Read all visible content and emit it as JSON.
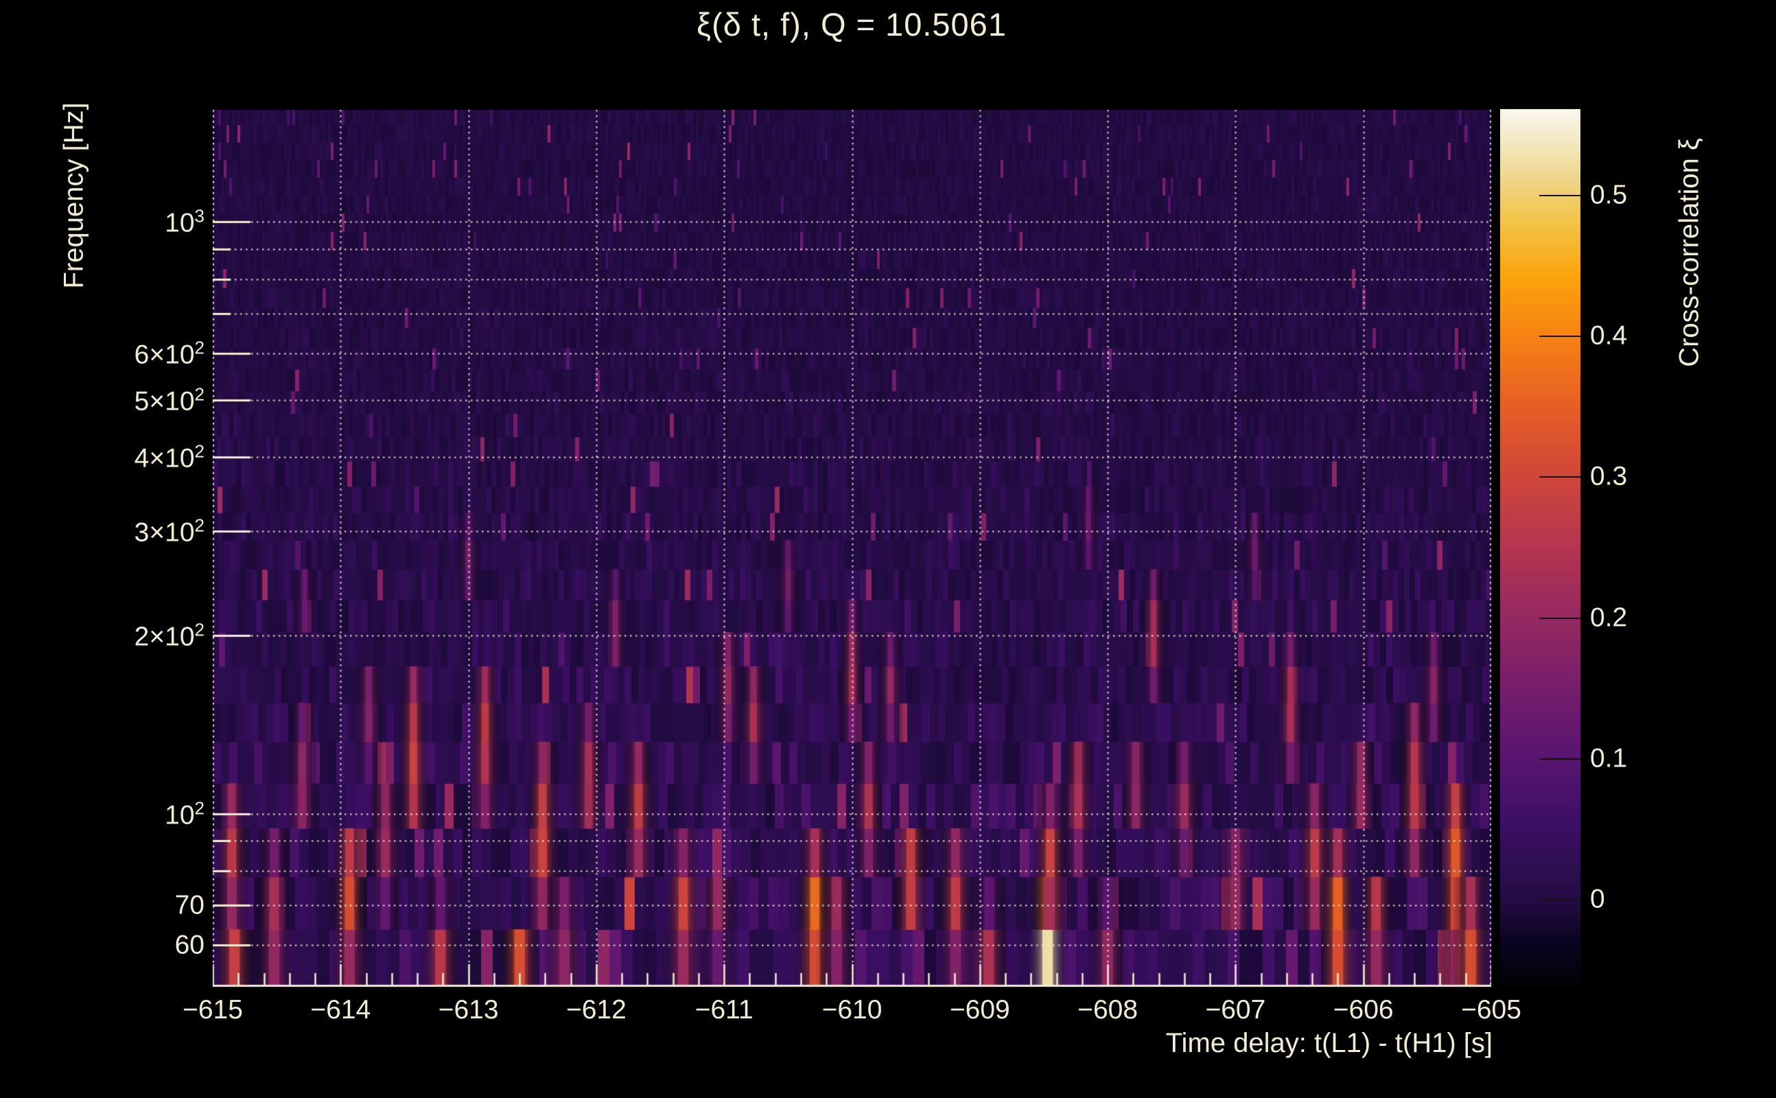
{
  "page": {
    "title": "ξ(δ t, f), Q = 10.5061",
    "background": "#000000",
    "text_color": "#f3ecd4"
  },
  "chart_data": {
    "type": "heatmap",
    "title": "ξ(δ t, f), Q = 10.5061",
    "q_value": "10.5061",
    "xlabel": "Time delay: t(L1) - t(H1) [s]",
    "ylabel": "Frequency [Hz]",
    "x_range": [
      -615,
      -605
    ],
    "x_minor_step": 0.2,
    "x_ticks": [
      {
        "label": "−615",
        "value": -615
      },
      {
        "label": "−614",
        "value": -614
      },
      {
        "label": "−613",
        "value": -613
      },
      {
        "label": "−612",
        "value": -612
      },
      {
        "label": "−611",
        "value": -611
      },
      {
        "label": "−610",
        "value": -610
      },
      {
        "label": "−609",
        "value": -609
      },
      {
        "label": "−608",
        "value": -608
      },
      {
        "label": "−607",
        "value": -607
      },
      {
        "label": "−606",
        "value": -606
      },
      {
        "label": "−605",
        "value": -605
      }
    ],
    "y_scale": "log",
    "y_range": [
      51,
      1546
    ],
    "y_ticks": [
      {
        "label": "10",
        "sup": "3",
        "value": 1000
      },
      {
        "label": "6×10",
        "sup": "2",
        "value": 600
      },
      {
        "label": "5×10",
        "sup": "2",
        "value": 500
      },
      {
        "label": "4×10",
        "sup": "2",
        "value": 400
      },
      {
        "label": "3×10",
        "sup": "2",
        "value": 300
      },
      {
        "label": "2×10",
        "sup": "2",
        "value": 200
      },
      {
        "label": "10",
        "sup": "2",
        "value": 100
      },
      {
        "label": "70",
        "sup": "",
        "value": 70
      },
      {
        "label": "60",
        "sup": "",
        "value": 60
      }
    ],
    "y_minor_gridlines": [
      900,
      800,
      700,
      90,
      80
    ],
    "grid": {
      "style": "dotted",
      "color": "#f6efd8"
    },
    "colorbar": {
      "label": "Cross-correlation ξ",
      "min": -0.063,
      "max": 0.561,
      "ticks": [
        {
          "label": "0.5",
          "value": 0.5
        },
        {
          "label": "0.4",
          "value": 0.4
        },
        {
          "label": "0.3",
          "value": 0.3
        },
        {
          "label": "0.2",
          "value": 0.2
        },
        {
          "label": "0.1",
          "value": 0.1
        },
        {
          "label": "0",
          "value": 0
        }
      ]
    },
    "colormap": {
      "name": "inferno-like",
      "stops": [
        [
          0.0,
          "#020104"
        ],
        [
          0.05,
          "#0a0420"
        ],
        [
          0.101,
          "#240c44"
        ],
        [
          0.18,
          "#3b0f63"
        ],
        [
          0.261,
          "#581570"
        ],
        [
          0.34,
          "#751d6c"
        ],
        [
          0.42,
          "#942961"
        ],
        [
          0.5,
          "#b33550"
        ],
        [
          0.58,
          "#cf463b"
        ],
        [
          0.66,
          "#e55e25"
        ],
        [
          0.74,
          "#f58212"
        ],
        [
          0.81,
          "#fba40c"
        ],
        [
          0.87,
          "#f3c245"
        ],
        [
          0.92,
          "#eed688"
        ],
        [
          0.965,
          "#f4e9c5"
        ],
        [
          1.0,
          "#f9f6ee"
        ]
      ]
    },
    "noise": {
      "seed": 9,
      "description": "stochastic constant-Q tile background, variance increasing toward low frequency"
    },
    "features": [
      {
        "t": -614.85,
        "f1": 70,
        "f2": 105,
        "xi": 0.26
      },
      {
        "t": -614.83,
        "f1": 50,
        "f2": 60,
        "xi": 0.3
      },
      {
        "t": -614.52,
        "f1": 55,
        "f2": 80,
        "xi": 0.24
      },
      {
        "t": -614.3,
        "f1": 95,
        "f2": 135,
        "xi": 0.2
      },
      {
        "t": -614.28,
        "f1": 205,
        "f2": 255,
        "xi": 0.14
      },
      {
        "t": -613.93,
        "f1": 60,
        "f2": 90,
        "xi": 0.32
      },
      {
        "t": -613.78,
        "f1": 130,
        "f2": 175,
        "xi": 0.18
      },
      {
        "t": -613.65,
        "f1": 78,
        "f2": 108,
        "xi": 0.22
      },
      {
        "t": -613.43,
        "f1": 95,
        "f2": 160,
        "xi": 0.29
      },
      {
        "t": -613.22,
        "f1": 52,
        "f2": 64,
        "xi": 0.26
      },
      {
        "t": -613.0,
        "f1": 235,
        "f2": 300,
        "xi": 0.15
      },
      {
        "t": -612.87,
        "f1": 110,
        "f2": 170,
        "xi": 0.27
      },
      {
        "t": -612.6,
        "f1": 50,
        "f2": 60,
        "xi": 0.34
      },
      {
        "t": -612.42,
        "f1": 75,
        "f2": 115,
        "xi": 0.3
      },
      {
        "t": -612.25,
        "f1": 55,
        "f2": 70,
        "xi": 0.22
      },
      {
        "t": -612.06,
        "f1": 95,
        "f2": 135,
        "xi": 0.24
      },
      {
        "t": -611.85,
        "f1": 180,
        "f2": 230,
        "xi": 0.18
      },
      {
        "t": -611.67,
        "f1": 85,
        "f2": 122,
        "xi": 0.27
      },
      {
        "t": -611.32,
        "f1": 58,
        "f2": 80,
        "xi": 0.3
      },
      {
        "t": -611.05,
        "f1": 60,
        "f2": 75,
        "xi": 0.22
      },
      {
        "t": -610.97,
        "f1": 140,
        "f2": 200,
        "xi": 0.2
      },
      {
        "t": -610.77,
        "f1": 128,
        "f2": 168,
        "xi": 0.24
      },
      {
        "t": -610.5,
        "f1": 215,
        "f2": 280,
        "xi": 0.15
      },
      {
        "t": -610.29,
        "f1": 55,
        "f2": 80,
        "xi": 0.38
      },
      {
        "t": -610.12,
        "f1": 58,
        "f2": 72,
        "xi": 0.26
      },
      {
        "t": -610.0,
        "f1": 150,
        "f2": 205,
        "xi": 0.23
      },
      {
        "t": -609.87,
        "f1": 88,
        "f2": 120,
        "xi": 0.24
      },
      {
        "t": -609.7,
        "f1": 145,
        "f2": 185,
        "xi": 0.2
      },
      {
        "t": -609.54,
        "f1": 64,
        "f2": 94,
        "xi": 0.3
      },
      {
        "t": -609.19,
        "f1": 60,
        "f2": 85,
        "xi": 0.27
      },
      {
        "t": -608.93,
        "f1": 52,
        "f2": 64,
        "xi": 0.24
      },
      {
        "t": -608.47,
        "f1": 49,
        "f2": 70,
        "xi": 0.53
      },
      {
        "t": -608.45,
        "f1": 70,
        "f2": 95,
        "xi": 0.3
      },
      {
        "t": -608.23,
        "f1": 90,
        "f2": 130,
        "xi": 0.24
      },
      {
        "t": -608.15,
        "f1": 275,
        "f2": 350,
        "xi": 0.14
      },
      {
        "t": -608.0,
        "f1": 54,
        "f2": 66,
        "xi": 0.21
      },
      {
        "t": -607.78,
        "f1": 95,
        "f2": 130,
        "xi": 0.2
      },
      {
        "t": -607.64,
        "f1": 175,
        "f2": 230,
        "xi": 0.24
      },
      {
        "t": -607.4,
        "f1": 90,
        "f2": 120,
        "xi": 0.21
      },
      {
        "t": -607.0,
        "f1": 64,
        "f2": 90,
        "xi": 0.21
      },
      {
        "t": -606.85,
        "f1": 245,
        "f2": 320,
        "xi": 0.14
      },
      {
        "t": -606.57,
        "f1": 130,
        "f2": 180,
        "xi": 0.24
      },
      {
        "t": -606.38,
        "f1": 70,
        "f2": 100,
        "xi": 0.27
      },
      {
        "t": -606.2,
        "f1": 54,
        "f2": 80,
        "xi": 0.37
      },
      {
        "t": -606.02,
        "f1": 95,
        "f2": 130,
        "xi": 0.22
      },
      {
        "t": -605.9,
        "f1": 58,
        "f2": 74,
        "xi": 0.29
      },
      {
        "t": -605.6,
        "f1": 88,
        "f2": 140,
        "xi": 0.27
      },
      {
        "t": -605.45,
        "f1": 140,
        "f2": 190,
        "xi": 0.18
      },
      {
        "t": -605.28,
        "f1": 63,
        "f2": 110,
        "xi": 0.34
      },
      {
        "t": -605.16,
        "f1": 50,
        "f2": 70,
        "xi": 0.32
      }
    ]
  }
}
